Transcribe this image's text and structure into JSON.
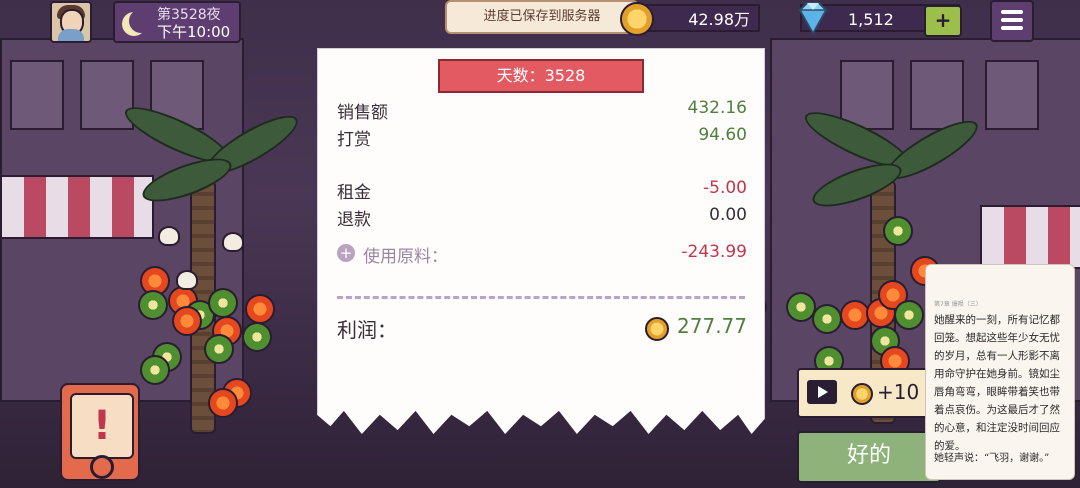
{
  "topbar": {
    "day_label": "第3528夜",
    "time_label": "下午10:00",
    "toast": "进度已保存到服务器",
    "coins": "42.98万",
    "gems": "1,512",
    "add_label": "+"
  },
  "receipt": {
    "title": "天数：3528",
    "sales_label": "销售额",
    "sales_value": "432.16",
    "tips_label": "打赏",
    "tips_value": "94.60",
    "rent_label": "租金",
    "rent_value": "-5.00",
    "refund_label": "退款",
    "refund_value": "0.00",
    "raw_label": "使用原料：",
    "raw_value": "-243.99",
    "raw_icon": "+",
    "profit_label": "利润：",
    "profit_value": "277.77"
  },
  "ad": {
    "amount": "+10"
  },
  "ok_label": "好的",
  "alert_symbol": "!",
  "story": {
    "header": "第7章 爆陨（三）",
    "body": "她醒来的一刻，所有记忆都回笼。想起这些年少女无忧的岁月，总有一人形影不离用命守护在她身前。镜如尘唇角弯弯，眼眸带着笑也带着点哀伤。为这最后才了然的心意，和注定没时间回应的爱。",
    "tail": "她轻声说：“飞羽，谢谢。”"
  }
}
